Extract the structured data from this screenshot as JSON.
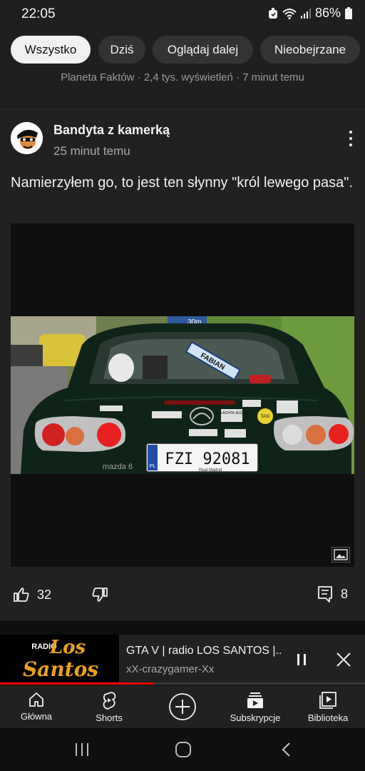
{
  "status_bar": {
    "time": "22:05",
    "battery": "86%",
    "icons": [
      "alarm-icon",
      "wifi-icon",
      "signal-icon",
      "battery-icon"
    ]
  },
  "filter_chips": [
    "Wszystko",
    "Dziś",
    "Oglądaj dalej",
    "Nieobejrzane"
  ],
  "active_chip": "Wszystko",
  "prev_item_meta": "Planeta Faktów · 2,4 tys. wyświetleń · 7 minut temu",
  "post": {
    "author": "Bandyta z kamerką",
    "time": "25 minut temu",
    "text": "Namierzyłem go, to jest ten słynny \"król lewego pasa\".",
    "photo": {
      "plate": "FZI 92081",
      "plate_country": "PL",
      "sticker": "FABIAN",
      "car_badge": "mazda 6",
      "dealer_text": "Real Madrid",
      "sign_text": "30m",
      "bumper_stickers": [
        "SZLACHTA JEDZIE",
        "TAXI"
      ]
    },
    "likes": "32",
    "comments": "8"
  },
  "mini_player": {
    "title": "GTA V | radio LOS SANTOS |..",
    "channel": "xX-crazygamer-Xx",
    "thumb_text_top": "RADIO",
    "thumb_text_mid": "Los",
    "thumb_text_bottom": "Santos",
    "progress": 0.42
  },
  "bottom_nav": [
    {
      "label": "Główna",
      "icon": "home-icon"
    },
    {
      "label": "Shorts",
      "icon": "shorts-icon"
    },
    {
      "label": "",
      "icon": "create-icon"
    },
    {
      "label": "Subskrypcje",
      "icon": "subscriptions-icon"
    },
    {
      "label": "Biblioteka",
      "icon": "library-icon"
    }
  ],
  "colors": {
    "background": "#0f0f0f",
    "surface": "#212121",
    "accent_red": "#ff0000"
  }
}
